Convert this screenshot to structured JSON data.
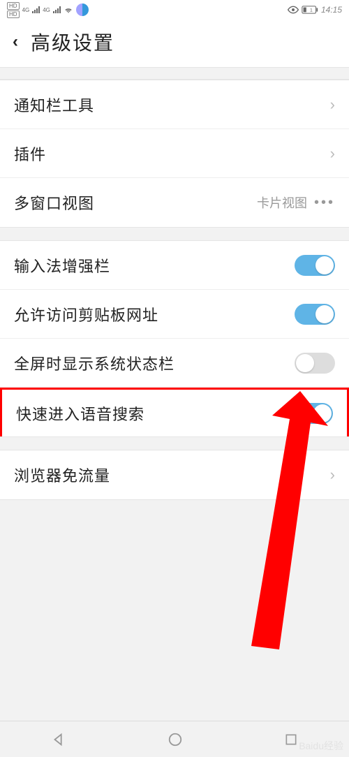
{
  "status_bar": {
    "time": "14:15",
    "hd_label": "HD",
    "network_type": "4G",
    "battery_label": "1"
  },
  "header": {
    "title": "高级设置"
  },
  "group1": {
    "notification_toolbar": "通知栏工具",
    "plugins": "插件",
    "multiwindow": "多窗口视图",
    "multiwindow_value": "卡片视图"
  },
  "group2": {
    "ime_enhance": "输入法增强栏",
    "clipboard_url": "允许访问剪贴板网址",
    "fullscreen_status": "全屏时显示系统状态栏",
    "voice_search": "快速进入语音搜索"
  },
  "group3": {
    "browser_dataless": "浏览器免流量"
  },
  "toggles": {
    "ime_enhance": true,
    "clipboard_url": true,
    "fullscreen_status": false,
    "voice_search": true
  },
  "watermark": "Baidu经验"
}
